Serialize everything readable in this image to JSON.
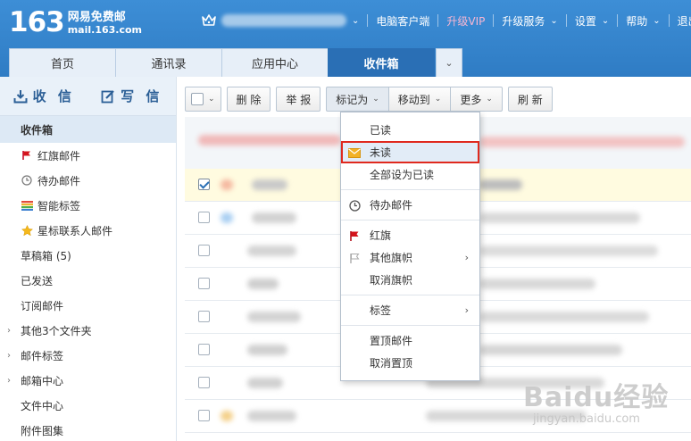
{
  "brand": {
    "number": "163",
    "name": "网易免费邮",
    "domain": "mail.163.com"
  },
  "topnav": {
    "items": [
      "电脑客户端",
      "升级VIP",
      "升级服务",
      "设置",
      "帮助",
      "退出"
    ]
  },
  "tabs": [
    "首页",
    "通讯录",
    "应用中心",
    "收件箱"
  ],
  "sidebar": {
    "receive": "收 信",
    "compose": "写 信",
    "folders": [
      {
        "label": "收件箱",
        "icon": ""
      },
      {
        "label": "红旗邮件",
        "icon": "red-flag-icon"
      },
      {
        "label": "待办邮件",
        "icon": "clock-icon"
      },
      {
        "label": "智能标签",
        "icon": "tag-stripes-icon"
      },
      {
        "label": "星标联系人邮件",
        "icon": "star-icon"
      },
      {
        "label": "草稿箱 (5)",
        "icon": ""
      },
      {
        "label": "已发送",
        "icon": ""
      },
      {
        "label": "订阅邮件",
        "icon": ""
      },
      {
        "label": "其他3个文件夹",
        "icon": "caret-right-icon"
      },
      {
        "label": "邮件标签",
        "icon": "caret-right-icon"
      },
      {
        "label": "邮箱中心",
        "icon": "caret-right-icon"
      },
      {
        "label": "文件中心",
        "icon": ""
      },
      {
        "label": "附件图集",
        "icon": ""
      }
    ]
  },
  "toolbar": {
    "delete": "删 除",
    "report": "举 报",
    "mark_as": "标记为",
    "move_to": "移动到",
    "more": "更多",
    "refresh": "刷 新"
  },
  "menu": {
    "items": [
      "已读",
      "未读",
      "全部设为已读",
      "待办邮件",
      "红旗",
      "其他旗帜",
      "取消旗帜",
      "标签",
      "置顶邮件",
      "取消置顶"
    ]
  },
  "watermark": {
    "main": "Baidu经验",
    "sub": "jingyan.baidu.com"
  },
  "colors": {
    "header": "#3d8ed6",
    "active_tab": "#2a6fb5",
    "highlight_border": "#e0291e",
    "vip": "#f7b6d2"
  }
}
